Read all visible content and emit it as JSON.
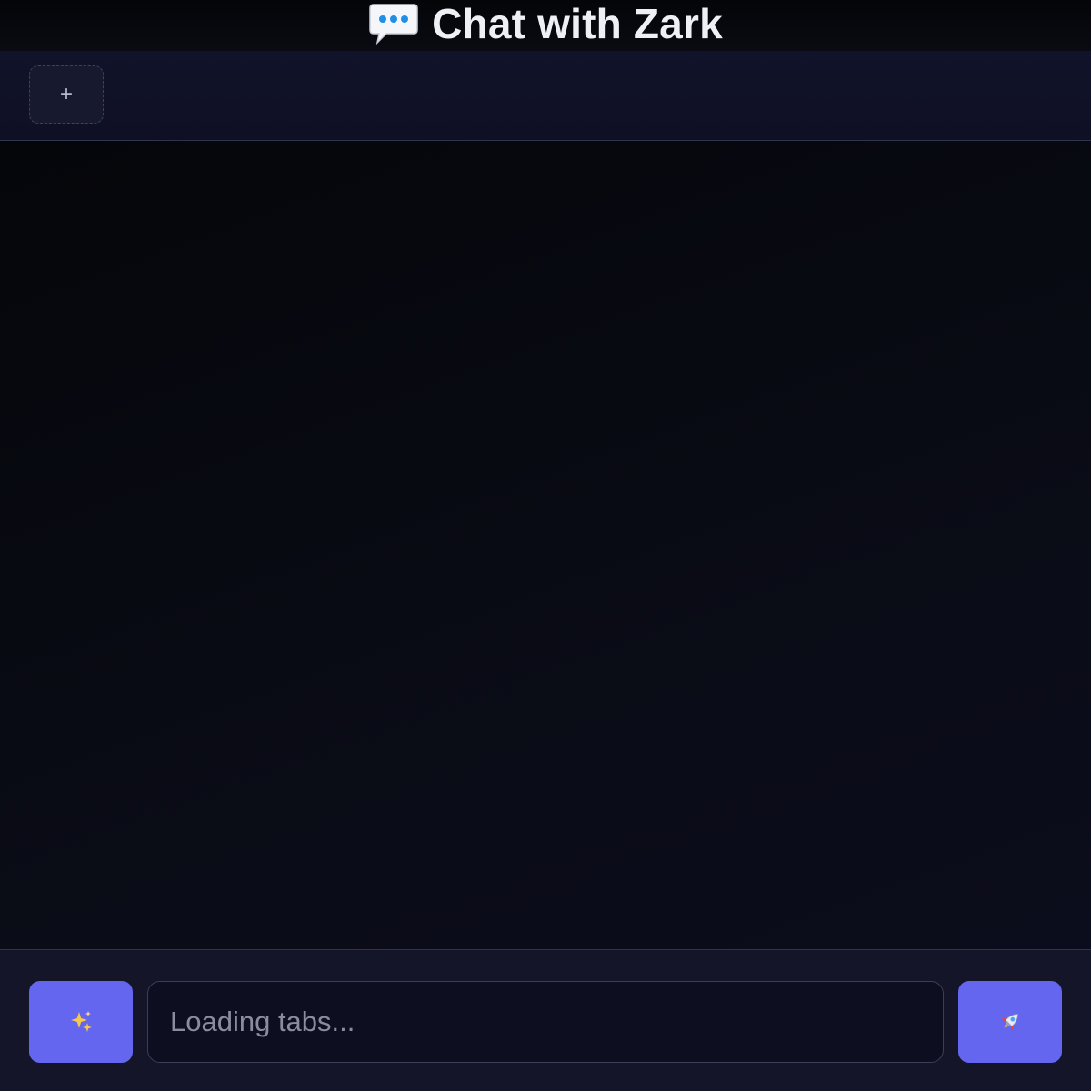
{
  "header": {
    "title": "Chat with Zark",
    "icon": "speech-bubble-icon"
  },
  "tabs": {
    "add_label": "+",
    "items": []
  },
  "composer": {
    "magic_icon": "sparkles-icon",
    "input_value": "",
    "input_placeholder": "Loading tabs...",
    "send_icon": "rocket-icon"
  },
  "colors": {
    "accent": "#6466f0",
    "background": "#07080d",
    "tabbar": "#10112a",
    "composer": "#141528",
    "text": "#eef0f6"
  }
}
